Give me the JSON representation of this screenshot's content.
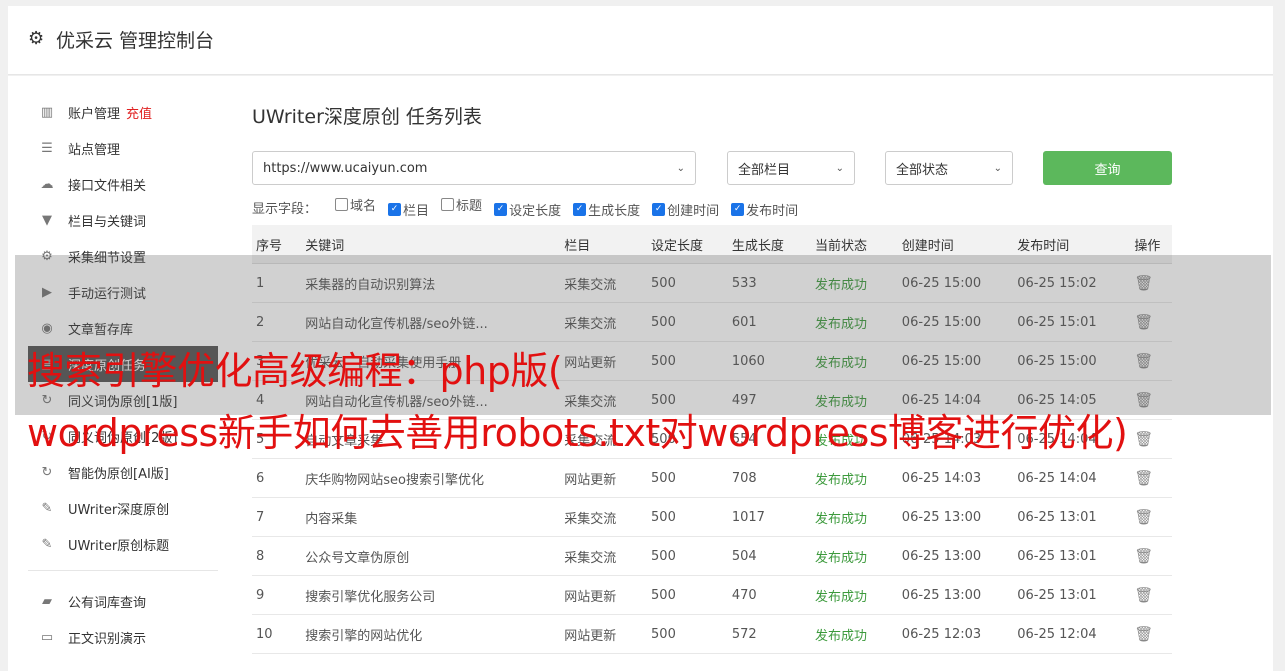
{
  "header": {
    "title": "优采云 管理控制台",
    "icon": "gear-icon"
  },
  "sidebar": {
    "group1": [
      {
        "icon": "bar-chart-icon",
        "glyph": "▥",
        "label": "账户管理",
        "extra": "充值"
      },
      {
        "icon": "server-icon",
        "glyph": "☰",
        "label": "站点管理"
      },
      {
        "icon": "cloud-upload-icon",
        "glyph": "☁",
        "label": "接口文件相关"
      },
      {
        "icon": "filter-icon",
        "glyph": "▼",
        "label": "栏目与关键词"
      },
      {
        "icon": "cogs-icon",
        "glyph": "⚙",
        "label": "采集细节设置"
      },
      {
        "icon": "play-icon",
        "glyph": "▶",
        "label": "手动运行测试"
      },
      {
        "icon": "database-icon",
        "glyph": "◉",
        "label": "文章暂存库"
      },
      {
        "icon": "document-icon",
        "glyph": "▤",
        "label": "深度原创任务"
      },
      {
        "icon": "refresh-icon",
        "glyph": "↻",
        "label": "同义词伪原创[1版]"
      },
      {
        "icon": "refresh-icon",
        "glyph": "↻",
        "label": "同义词伪原创[2版]"
      },
      {
        "icon": "refresh-icon",
        "glyph": "↻",
        "label": "智能伪原创[AI版]"
      },
      {
        "icon": "edit-icon",
        "glyph": "✎",
        "label": "UWriter深度原创"
      },
      {
        "icon": "edit-icon",
        "glyph": "✎",
        "label": "UWriter原创标题"
      }
    ],
    "group2": [
      {
        "icon": "book-icon",
        "glyph": "▰",
        "label": "公有词库查询"
      },
      {
        "icon": "monitor-icon",
        "glyph": "▭",
        "label": "正文识别演示"
      }
    ]
  },
  "main": {
    "title": "UWriter深度原创 任务列表",
    "site_select": "https://www.ucaiyun.com",
    "column_select": "全部栏目",
    "status_select": "全部状态",
    "query_label": "查询",
    "fields_label": "显示字段：",
    "fields": [
      {
        "label": "域名",
        "checked": false
      },
      {
        "label": "栏目",
        "checked": true
      },
      {
        "label": "标题",
        "checked": false
      },
      {
        "label": "设定长度",
        "checked": true
      },
      {
        "label": "生成长度",
        "checked": true
      },
      {
        "label": "创建时间",
        "checked": true
      },
      {
        "label": "发布时间",
        "checked": true
      }
    ],
    "columns": [
      "序号",
      "关键词",
      "栏目",
      "设定长度",
      "生成长度",
      "当前状态",
      "创建时间",
      "发布时间",
      "操作"
    ],
    "rows": [
      [
        "1",
        "采集器的自动识别算法",
        "采集交流",
        "500",
        "533",
        "发布成功",
        "06-25 15:00",
        "06-25 15:02"
      ],
      [
        "2",
        "网站自动化宣传机器/seo外链...",
        "采集交流",
        "500",
        "601",
        "发布成功",
        "06-25 15:00",
        "06-25 15:01"
      ],
      [
        "3",
        "优采云—自动采集使用手册",
        "网站更新",
        "500",
        "1060",
        "发布成功",
        "06-25 15:00",
        "06-25 15:00"
      ],
      [
        "4",
        "网站自动化宣传机器/seo外链...",
        "采集交流",
        "500",
        "497",
        "发布成功",
        "06-25 14:04",
        "06-25 14:05"
      ],
      [
        "5",
        "自动文章采集",
        "采集交流",
        "500",
        "554",
        "发布成功",
        "06-25 14:03",
        "06-25 14:04"
      ],
      [
        "6",
        "庆华购物网站seo搜索引擎优化",
        "网站更新",
        "500",
        "708",
        "发布成功",
        "06-25 14:03",
        "06-25 14:04"
      ],
      [
        "7",
        "内容采集",
        "采集交流",
        "500",
        "1017",
        "发布成功",
        "06-25 13:00",
        "06-25 13:01"
      ],
      [
        "8",
        "公众号文章伪原创",
        "采集交流",
        "500",
        "504",
        "发布成功",
        "06-25 13:00",
        "06-25 13:01"
      ],
      [
        "9",
        "搜索引擎优化服务公司",
        "网站更新",
        "500",
        "470",
        "发布成功",
        "06-25 13:00",
        "06-25 13:01"
      ],
      [
        "10",
        "搜索引擎的网站优化",
        "网站更新",
        "500",
        "572",
        "发布成功",
        "06-25 12:03",
        "06-25 12:04"
      ]
    ]
  },
  "overlay": {
    "line1": "搜索引擎优化高级编程：php版(",
    "line2": "wordpress新手如何去善用robots.txt对wordpress博客进行优化)"
  }
}
